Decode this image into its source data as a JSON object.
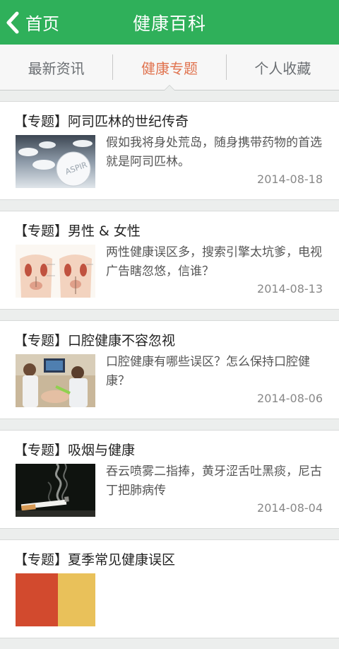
{
  "header": {
    "back_label": "首页",
    "title": "健康百科",
    "accent_color": "#2fb05a"
  },
  "tabs": [
    {
      "label": "最新资讯",
      "active": false
    },
    {
      "label": "健康专题",
      "active": true
    },
    {
      "label": "个人收藏",
      "active": false
    }
  ],
  "articles": [
    {
      "title": "【专题】阿司匹林的世纪传奇",
      "summary": "假如我将身处荒岛，随身携带药物的首选就是阿司匹林。",
      "date": "2014-08-18",
      "image": "aspirin-pills-image",
      "image_text": "ASPIR"
    },
    {
      "title": "【专题】男性 & 女性",
      "summary": "两性健康误区多，搜索引擎太坑爹，电视广告瞎忽悠，信谁？",
      "date": "2014-08-13",
      "image": "anatomy-diagram-image"
    },
    {
      "title": "【专题】口腔健康不容忽视",
      "summary": "口腔健康有哪些误区？怎么保持口腔健康？",
      "date": "2014-08-06",
      "image": "dental-clinic-image"
    },
    {
      "title": "【专题】吸烟与健康",
      "summary": "吞云喷雾二指捧，黄牙涩舌吐黑痰，尼古丁把肺病传",
      "date": "2014-08-04",
      "image": "cigarette-smoke-image"
    },
    {
      "title": "【专题】夏季常见健康误区",
      "summary": "",
      "date": "",
      "image": "summer-image"
    }
  ]
}
